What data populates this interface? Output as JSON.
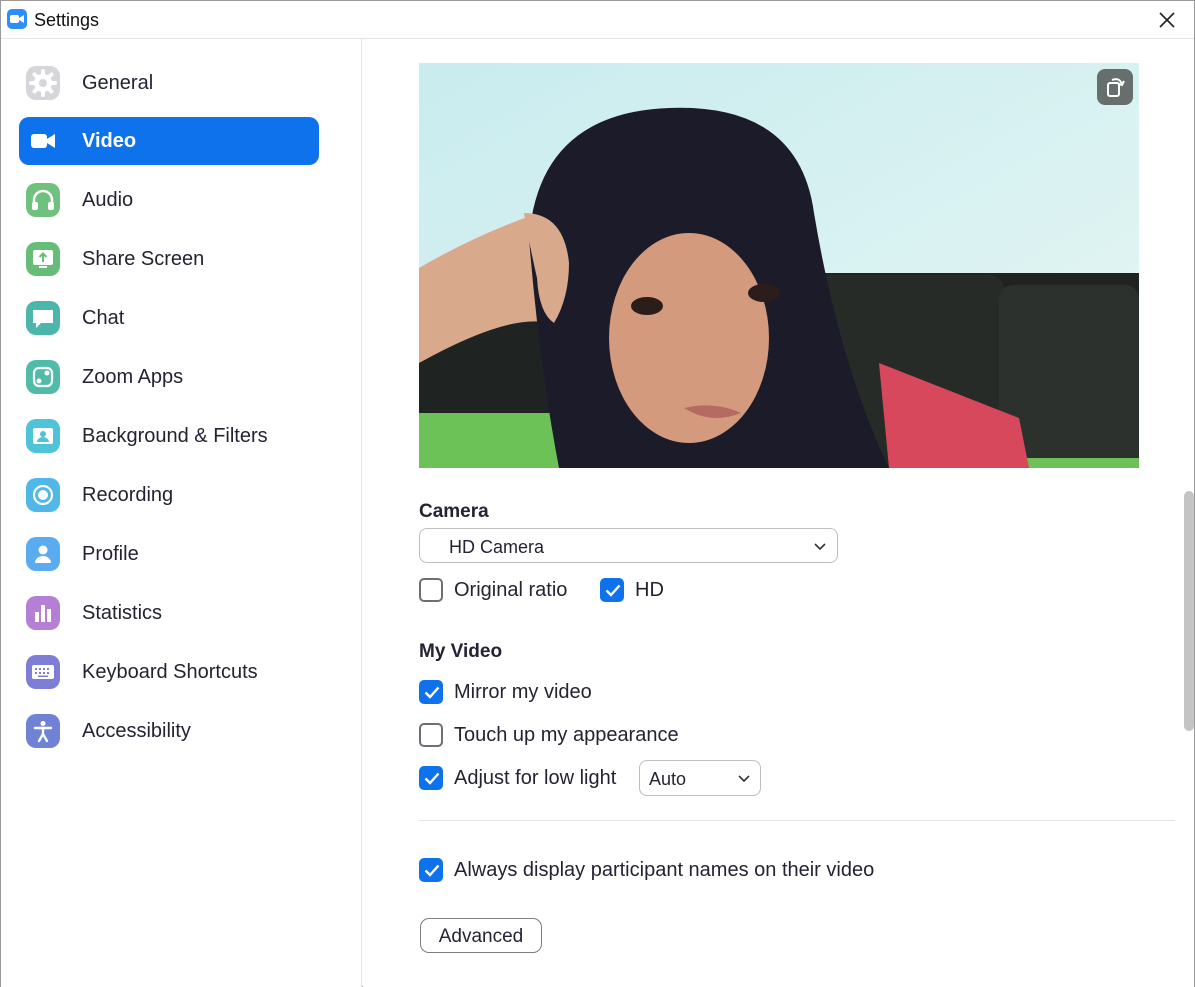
{
  "window": {
    "title": "Settings"
  },
  "sidebar": {
    "items": [
      {
        "label": "General",
        "icon": "gear-icon",
        "color": "#d0d0d4",
        "active": false
      },
      {
        "label": "Video",
        "icon": "video-camera-icon",
        "color": "#0e72ed",
        "active": true
      },
      {
        "label": "Audio",
        "icon": "headphones-icon",
        "color": "#6fc27e",
        "active": false
      },
      {
        "label": "Share Screen",
        "icon": "share-screen-icon",
        "color": "#66bd78",
        "active": false
      },
      {
        "label": "Chat",
        "icon": "chat-bubble-icon",
        "color": "#4db6ac",
        "active": false
      },
      {
        "label": "Zoom Apps",
        "icon": "apps-icon",
        "color": "#4fbba8",
        "active": false
      },
      {
        "label": "Background & Filters",
        "icon": "background-icon",
        "color": "#4fc3d8",
        "active": false
      },
      {
        "label": "Recording",
        "icon": "record-icon",
        "color": "#4fb8e8",
        "active": false
      },
      {
        "label": "Profile",
        "icon": "profile-icon",
        "color": "#5aabf0",
        "active": false
      },
      {
        "label": "Statistics",
        "icon": "statistics-icon",
        "color": "#b67fd6",
        "active": false
      },
      {
        "label": "Keyboard Shortcuts",
        "icon": "keyboard-icon",
        "color": "#7e7ed6",
        "active": false
      },
      {
        "label": "Accessibility",
        "icon": "accessibility-icon",
        "color": "#6f82d6",
        "active": false
      }
    ]
  },
  "main": {
    "camera": {
      "title": "Camera",
      "selected": "HD Camera",
      "original_ratio": {
        "label": "Original ratio",
        "checked": false
      },
      "hd": {
        "label": "HD",
        "checked": true
      }
    },
    "my_video": {
      "title": "My Video",
      "mirror": {
        "label": "Mirror my video",
        "checked": true
      },
      "touch_up": {
        "label": "Touch up my appearance",
        "checked": false
      },
      "low_light": {
        "label": "Adjust for low light",
        "checked": true,
        "mode": "Auto"
      }
    },
    "always_display_names": {
      "label": "Always display participant names on their video",
      "checked": true
    },
    "advanced_label": "Advanced"
  },
  "colors": {
    "accent": "#0e72ed",
    "brand": "#2d8cff"
  }
}
